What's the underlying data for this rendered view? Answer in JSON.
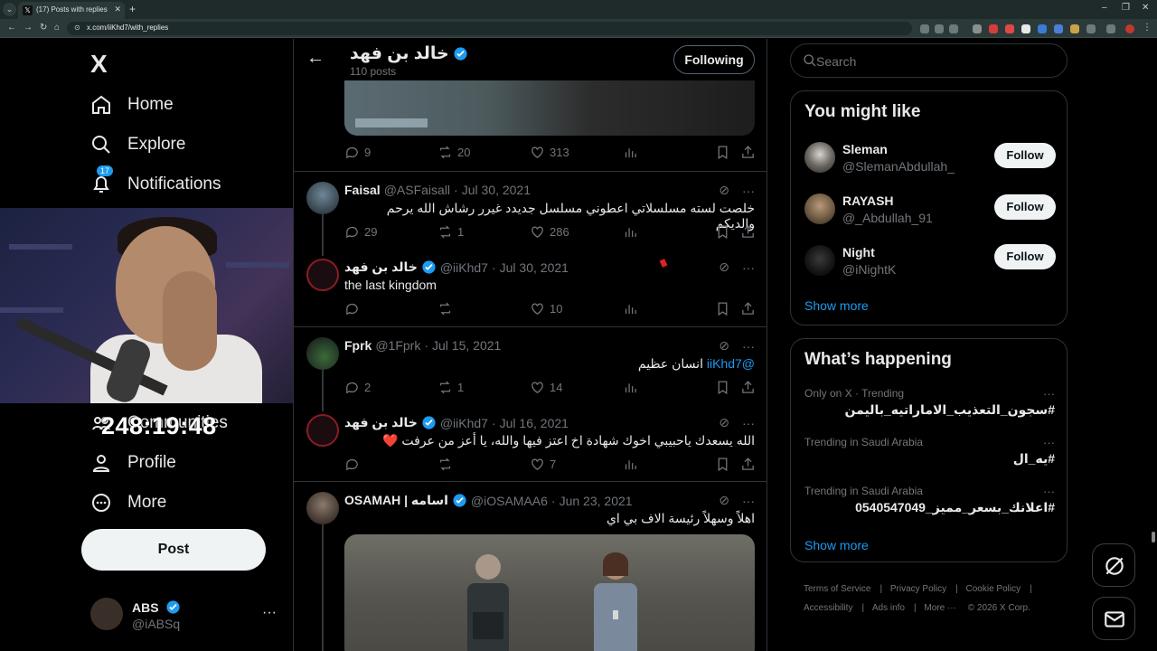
{
  "browser": {
    "tab_title": "(17) Posts with replies by خالد بن فهد",
    "url": "x.com/iiKhd7/with_replies"
  },
  "nav": {
    "logo": "X",
    "items": [
      {
        "label": "Home"
      },
      {
        "label": "Explore"
      },
      {
        "label": "Notifications",
        "badge": "17"
      },
      {
        "label": "Communities"
      },
      {
        "label": "Profile"
      },
      {
        "label": "More"
      }
    ],
    "post_label": "Post",
    "account": {
      "name": "ABS",
      "handle": "@iABSq"
    }
  },
  "overlay": {
    "timer": "248:19:48"
  },
  "header": {
    "name": "خالد بن فهد",
    "post_count": "110 posts",
    "following_label": "Following"
  },
  "tweets": [
    {
      "stats": {
        "replies": "9",
        "retweets": "20",
        "likes": "313"
      }
    },
    {
      "name": "Faisal",
      "handle": "@ASFaisall",
      "date": "Jul 30, 2021",
      "text": "خلصت لسته مسلسلاتي اعطوني مسلسل جديدد غيرر رشاش الله يرحم والديكم",
      "stats": {
        "replies": "29",
        "retweets": "1",
        "likes": "286"
      }
    },
    {
      "name": "خالد بن فهد",
      "handle": "@iiKhd7",
      "date": "Jul 30, 2021",
      "text": "the last kingdom",
      "stats": {
        "replies": "",
        "retweets": "",
        "likes": "10"
      }
    },
    {
      "name": "Fprk",
      "handle": "@1Fprk",
      "date": "Jul 15, 2021",
      "mention": "@iiKhd7",
      "text": "انسان عظيم",
      "stats": {
        "replies": "2",
        "retweets": "1",
        "likes": "14"
      }
    },
    {
      "name": "خالد بن فهد",
      "handle": "@iiKhd7",
      "date": "Jul 16, 2021",
      "text": "الله يسعدك ياحبيبي اخوك شهادة اخ اعتز فيها والله، يا أعز من عرفت ❤️",
      "stats": {
        "replies": "",
        "retweets": "",
        "likes": "7"
      }
    },
    {
      "name": "OSAMAH | اسامه",
      "handle": "@iOSAMAA6",
      "date": "Jun 23, 2021",
      "text": "اهلاً وسهلاً رئيسة الاف بي اي"
    }
  ],
  "search": {
    "placeholder": "Search"
  },
  "you_might_like": {
    "title": "You might like",
    "users": [
      {
        "name": "Sleman",
        "handle": "@SlemanAbdullah_",
        "button": "Follow"
      },
      {
        "name": "RAYASH",
        "handle": "@_Abdullah_91",
        "button": "Follow"
      },
      {
        "name": "Night",
        "handle": "@iNightK",
        "button": "Follow"
      }
    ],
    "show_more": "Show more"
  },
  "whats_happening": {
    "title": "What’s happening",
    "trends": [
      {
        "meta": "Only on X · Trending",
        "name": "#سجون_التعذيب_الاماراتيه_باليمن"
      },
      {
        "meta": "Trending in Saudi Arabia",
        "name": "#يه_ال"
      },
      {
        "meta": "Trending in Saudi Arabia",
        "name": "#اعلانك_بسعر_مميز_0540547049"
      }
    ],
    "show_more": "Show more"
  },
  "footer": {
    "links": [
      "Terms of Service",
      "Privacy Policy",
      "Cookie Policy",
      "Accessibility",
      "Ads info",
      "More ···",
      "© 2026 X Corp."
    ]
  },
  "colors": {
    "accent": "#1d9bf0",
    "background": "#000000",
    "border": "#2f3336",
    "muted": "#71767b",
    "like_red": "#f91880"
  }
}
